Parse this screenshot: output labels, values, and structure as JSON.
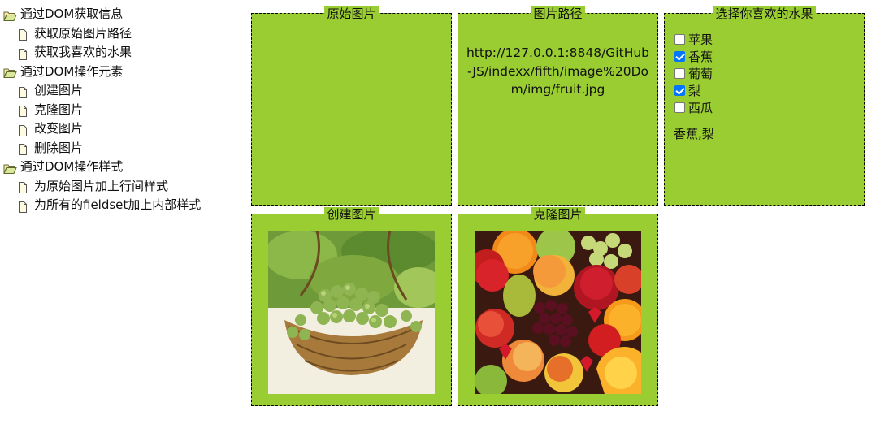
{
  "tree": {
    "groups": [
      {
        "label": "通过DOM获取信息",
        "items": [
          "获取原始图片路径",
          "获取我喜欢的水果"
        ]
      },
      {
        "label": "通过DOM操作元素",
        "items": [
          "创建图片",
          "克隆图片",
          "改变图片",
          "删除图片"
        ]
      },
      {
        "label": "通过DOM操作样式",
        "items": [
          "为原始图片加上行间样式",
          "为所有的fieldset加上内部样式"
        ]
      }
    ]
  },
  "panels": {
    "original": {
      "legend": "原始图片"
    },
    "path": {
      "legend": "图片路径",
      "text": "http://127.0.0.1:8848/GitHub-JS/indexx/fifth/image%20Dom/img/fruit.jpg"
    },
    "fruits": {
      "legend": "选择你喜欢的水果",
      "options": [
        {
          "label": "苹果",
          "checked": false
        },
        {
          "label": "香蕉",
          "checked": true
        },
        {
          "label": "葡萄",
          "checked": false
        },
        {
          "label": "梨",
          "checked": true
        },
        {
          "label": "西瓜",
          "checked": false
        }
      ],
      "selected_text": "香蕉,梨"
    },
    "create": {
      "legend": "创建图片",
      "image": "grape-basket-photo"
    },
    "clone": {
      "legend": "克隆图片",
      "image": "mixed-fruit-photo"
    }
  },
  "colors": {
    "panel_background": "#9acd32",
    "panel_border": "#000000",
    "checkbox_checked": "#0075ff"
  },
  "icons": {
    "group": "folder-open-icon",
    "leaf": "document-icon"
  }
}
